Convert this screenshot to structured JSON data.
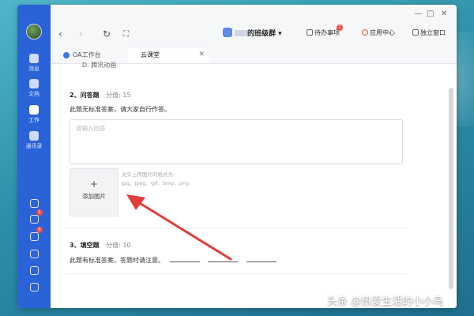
{
  "rail": {
    "items": [
      {
        "label": "消息"
      },
      {
        "label": "文档"
      },
      {
        "label": "工作"
      },
      {
        "label": "通讯录"
      }
    ],
    "badges": [
      "1",
      "9"
    ]
  },
  "window_controls": [
    "—",
    "□",
    "✕"
  ],
  "toolbar": {
    "back": "‹",
    "forward": "›",
    "refresh": "↻",
    "fullscreen": "⛶",
    "group_name": "的班级群",
    "group_dropdown": "▾",
    "todo_label": "待办事项",
    "todo_badge": "1",
    "apps_label": "应用中心",
    "open_window_label": "独立窗口"
  },
  "tabs": [
    {
      "label": "OA工作台"
    },
    {
      "label": "云课堂"
    }
  ],
  "content": {
    "prev_option": "D. 腾讯动画",
    "q2": {
      "title": "2、问答题",
      "score": "分值: 15",
      "desc": "此题无标准答案，请大家自行作答。",
      "answer_placeholder": "请输入回答",
      "upload_plus": "+",
      "upload_label": "添加图片",
      "hint_line1": "允许上传图片的格式为:",
      "hint_line2": "jpg、jpeg、gif、bmp、png"
    },
    "q3": {
      "title": "3、填空题",
      "score": "分值: 10",
      "desc": "此题有标准答案，答题时请注意。"
    }
  },
  "watermark": "头条 @热爱生活的小小鸟",
  "colors": {
    "rail": "#2a62d8",
    "arrow": "#e23b3b"
  }
}
